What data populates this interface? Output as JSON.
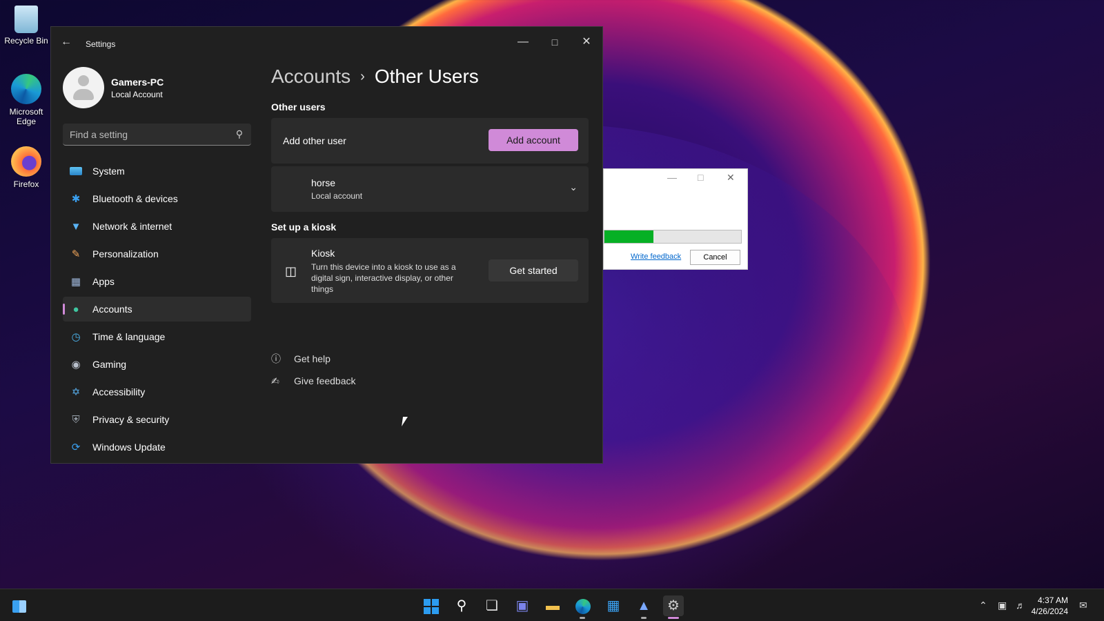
{
  "desktop": {
    "icons": [
      {
        "label": "Recycle Bin"
      },
      {
        "label": "Microsoft Edge"
      },
      {
        "label": "Firefox"
      }
    ]
  },
  "settings": {
    "title": "Settings",
    "profile": {
      "name": "Gamers-PC",
      "type": "Local Account"
    },
    "search": {
      "placeholder": "Find a setting"
    },
    "nav": [
      {
        "label": "System",
        "icon": "monitor-icon"
      },
      {
        "label": "Bluetooth & devices",
        "icon": "bluetooth-icon"
      },
      {
        "label": "Network & internet",
        "icon": "wifi-icon"
      },
      {
        "label": "Personalization",
        "icon": "brush-icon"
      },
      {
        "label": "Apps",
        "icon": "apps-icon"
      },
      {
        "label": "Accounts",
        "icon": "person-icon",
        "active": true
      },
      {
        "label": "Time & language",
        "icon": "globe-clock-icon"
      },
      {
        "label": "Gaming",
        "icon": "controller-icon"
      },
      {
        "label": "Accessibility",
        "icon": "accessibility-icon"
      },
      {
        "label": "Privacy & security",
        "icon": "shield-icon"
      },
      {
        "label": "Windows Update",
        "icon": "refresh-icon"
      }
    ],
    "breadcrumb": {
      "parent": "Accounts",
      "current": "Other Users"
    },
    "other_users": {
      "section_title": "Other users",
      "add_label": "Add other user",
      "add_button": "Add account",
      "user": {
        "name": "horse",
        "type": "Local account"
      }
    },
    "kiosk": {
      "section_title": "Set up a kiosk",
      "name": "Kiosk",
      "description": "Turn this device into a kiosk to use as a digital sign, interactive display, or other things",
      "button": "Get started"
    },
    "help": {
      "get_help": "Get help",
      "give_feedback": "Give feedback"
    }
  },
  "dialog": {
    "progress_percent": 36,
    "feedback_link": "Write feedback",
    "cancel_button": "Cancel"
  },
  "taskbar": {
    "time": "4:37 AM",
    "date": "4/26/2024"
  },
  "colors": {
    "accent": "#d08ad8",
    "window_bg": "#202020",
    "card_bg": "#2b2b2b",
    "progress_green": "#06b025"
  }
}
